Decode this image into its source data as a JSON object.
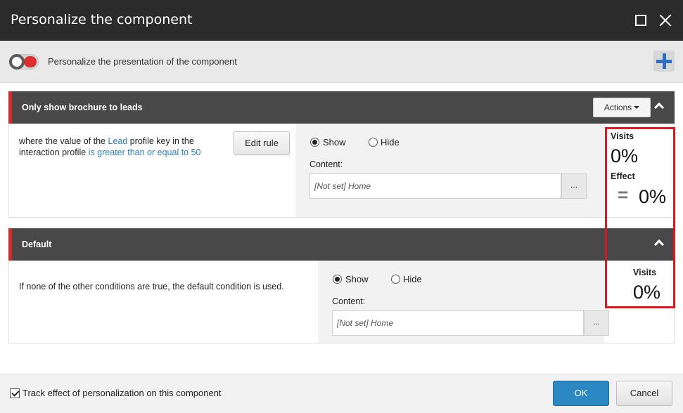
{
  "dialog": {
    "title": "Personalize the component"
  },
  "toolbar": {
    "toggle_label": "Personalize the presentation of the component",
    "toggle_on": false
  },
  "rules": [
    {
      "name": "Only show brochure to leads",
      "actions_label": "Actions",
      "condition": {
        "part1": "where the value of the ",
        "link1": "Lead",
        "part2": " profile key in the interaction profile ",
        "link2": "is greater than or equal to 50"
      },
      "edit_rule_label": "Edit rule",
      "show_label": "Show",
      "hide_label": "Hide",
      "selected": "Show",
      "content_label": "Content:",
      "content_value": "[Not set] Home",
      "browse_label": "...",
      "visits_label": "Visits",
      "visits_value": "0%",
      "effect_label": "Effect",
      "effect_symbol": "=",
      "effect_value": "0%"
    },
    {
      "name": "Default",
      "condition_text": "If none of the other conditions are true, the default condition is used.",
      "show_label": "Show",
      "hide_label": "Hide",
      "selected": "Show",
      "content_label": "Content:",
      "content_value": "[Not set] Home",
      "browse_label": "...",
      "visits_label": "Visits",
      "visits_value": "0%"
    }
  ],
  "footer": {
    "track_label": "Track effect of personalization on this component",
    "track_checked": true,
    "ok_label": "OK",
    "cancel_label": "Cancel"
  },
  "colors": {
    "title_bar": "#2b2b2b",
    "section_header": "#484848",
    "rule_accent": "#d62a2a",
    "link": "#2a7fb8",
    "ok_button": "#2b88c3",
    "highlight_box": "#e3161d",
    "add_icon": "#2d6fbe"
  },
  "icons": {
    "maximize": "maximize-icon",
    "close": "close-icon",
    "add": "plus-icon",
    "collapse": "chevron-up-icon",
    "dropdown": "caret-down-icon"
  }
}
